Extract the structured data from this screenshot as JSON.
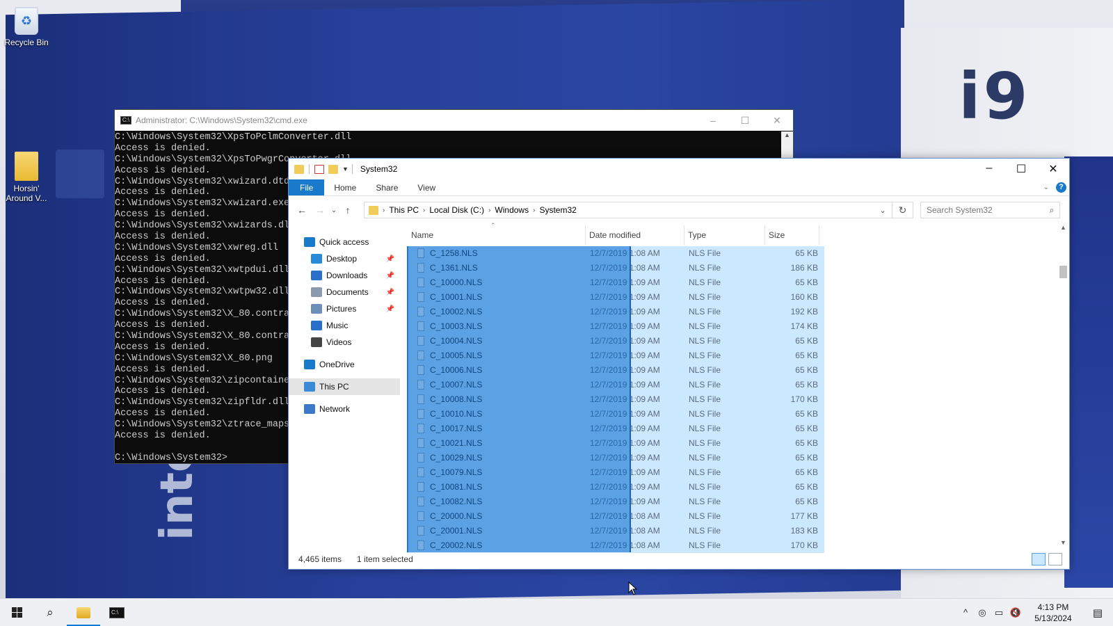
{
  "desktop": {
    "icons": [
      {
        "label": "Recycle Bin"
      },
      {
        "label": "Horsin' Around V..."
      }
    ],
    "wallpaper": {
      "logo_text": "i9",
      "brand_text": "intel CORE"
    }
  },
  "cmd": {
    "title": "Administrator: C:\\Windows\\System32\\cmd.exe",
    "lines": [
      "C:\\Windows\\System32\\XpsToPclmConverter.dll",
      "Access is denied.",
      "C:\\Windows\\System32\\XpsToPwgrConverter.dll",
      "Access is denied.",
      "C:\\Windows\\System32\\xwizard.dtd",
      "Access is denied.",
      "C:\\Windows\\System32\\xwizard.exe",
      "Access is denied.",
      "C:\\Windows\\System32\\xwizards.dll",
      "Access is denied.",
      "C:\\Windows\\System32\\xwreg.dll",
      "Access is denied.",
      "C:\\Windows\\System32\\xwtpdui.dll",
      "Access is denied.",
      "C:\\Windows\\System32\\xwtpw32.dll",
      "Access is denied.",
      "C:\\Windows\\System32\\X_80.contrast-black.png",
      "Access is denied.",
      "C:\\Windows\\System32\\X_80.contrast-white.png",
      "Access is denied.",
      "C:\\Windows\\System32\\X_80.png",
      "Access is denied.",
      "C:\\Windows\\System32\\zipcontainer.dll",
      "Access is denied.",
      "C:\\Windows\\System32\\zipfldr.dll",
      "Access is denied.",
      "C:\\Windows\\System32\\ztrace_maps.dll",
      "Access is denied.",
      "",
      "C:\\Windows\\System32>"
    ]
  },
  "explorer": {
    "title": "System32",
    "ribbon_tabs": [
      "File",
      "Home",
      "Share",
      "View"
    ],
    "breadcrumb": [
      "This PC",
      "Local Disk (C:)",
      "Windows",
      "System32"
    ],
    "search_placeholder": "Search System32",
    "nav": [
      {
        "label": "Quick access",
        "icon": "star-icon",
        "color": "#1979ca",
        "indent": 0,
        "pinned": false
      },
      {
        "label": "Desktop",
        "icon": "desktop-icon",
        "color": "#2a8ad8",
        "indent": 1,
        "pinned": true
      },
      {
        "label": "Downloads",
        "icon": "download-icon",
        "color": "#2a6fc9",
        "indent": 1,
        "pinned": true
      },
      {
        "label": "Documents",
        "icon": "documents-icon",
        "color": "#8a9bb0",
        "indent": 1,
        "pinned": true
      },
      {
        "label": "Pictures",
        "icon": "pictures-icon",
        "color": "#6b8fb8",
        "indent": 1,
        "pinned": true
      },
      {
        "label": "Music",
        "icon": "music-icon",
        "color": "#2a6fc9",
        "indent": 1,
        "pinned": false
      },
      {
        "label": "Videos",
        "icon": "videos-icon",
        "color": "#444",
        "indent": 1,
        "pinned": false
      },
      {
        "label": "OneDrive",
        "icon": "cloud-icon",
        "color": "#1979ca",
        "indent": 0,
        "pinned": false
      },
      {
        "label": "This PC",
        "icon": "computer-icon",
        "color": "#3a8ad8",
        "indent": 0,
        "pinned": false,
        "selected": true
      },
      {
        "label": "Network",
        "icon": "network-icon",
        "color": "#3a7ac8",
        "indent": 0,
        "pinned": false
      }
    ],
    "columns": [
      "Name",
      "Date modified",
      "Type",
      "Size"
    ],
    "files": [
      {
        "name": "C_1258.NLS",
        "date": "12/7/2019 1:08 AM",
        "type": "NLS File",
        "size": "65 KB"
      },
      {
        "name": "C_1361.NLS",
        "date": "12/7/2019 1:08 AM",
        "type": "NLS File",
        "size": "186 KB"
      },
      {
        "name": "C_10000.NLS",
        "date": "12/7/2019 1:09 AM",
        "type": "NLS File",
        "size": "65 KB"
      },
      {
        "name": "C_10001.NLS",
        "date": "12/7/2019 1:09 AM",
        "type": "NLS File",
        "size": "160 KB"
      },
      {
        "name": "C_10002.NLS",
        "date": "12/7/2019 1:09 AM",
        "type": "NLS File",
        "size": "192 KB"
      },
      {
        "name": "C_10003.NLS",
        "date": "12/7/2019 1:09 AM",
        "type": "NLS File",
        "size": "174 KB"
      },
      {
        "name": "C_10004.NLS",
        "date": "12/7/2019 1:09 AM",
        "type": "NLS File",
        "size": "65 KB"
      },
      {
        "name": "C_10005.NLS",
        "date": "12/7/2019 1:09 AM",
        "type": "NLS File",
        "size": "65 KB"
      },
      {
        "name": "C_10006.NLS",
        "date": "12/7/2019 1:09 AM",
        "type": "NLS File",
        "size": "65 KB"
      },
      {
        "name": "C_10007.NLS",
        "date": "12/7/2019 1:09 AM",
        "type": "NLS File",
        "size": "65 KB"
      },
      {
        "name": "C_10008.NLS",
        "date": "12/7/2019 1:09 AM",
        "type": "NLS File",
        "size": "170 KB"
      },
      {
        "name": "C_10010.NLS",
        "date": "12/7/2019 1:09 AM",
        "type": "NLS File",
        "size": "65 KB"
      },
      {
        "name": "C_10017.NLS",
        "date": "12/7/2019 1:09 AM",
        "type": "NLS File",
        "size": "65 KB"
      },
      {
        "name": "C_10021.NLS",
        "date": "12/7/2019 1:09 AM",
        "type": "NLS File",
        "size": "65 KB"
      },
      {
        "name": "C_10029.NLS",
        "date": "12/7/2019 1:09 AM",
        "type": "NLS File",
        "size": "65 KB"
      },
      {
        "name": "C_10079.NLS",
        "date": "12/7/2019 1:09 AM",
        "type": "NLS File",
        "size": "65 KB"
      },
      {
        "name": "C_10081.NLS",
        "date": "12/7/2019 1:09 AM",
        "type": "NLS File",
        "size": "65 KB"
      },
      {
        "name": "C_10082.NLS",
        "date": "12/7/2019 1:09 AM",
        "type": "NLS File",
        "size": "65 KB"
      },
      {
        "name": "C_20000.NLS",
        "date": "12/7/2019 1:08 AM",
        "type": "NLS File",
        "size": "177 KB"
      },
      {
        "name": "C_20001.NLS",
        "date": "12/7/2019 1:08 AM",
        "type": "NLS File",
        "size": "183 KB"
      },
      {
        "name": "C_20002.NLS",
        "date": "12/7/2019 1:08 AM",
        "type": "NLS File",
        "size": "170 KB"
      }
    ],
    "status": {
      "items": "4,465 items",
      "selected": "1 item selected"
    }
  },
  "taskbar": {
    "time": "4:13 PM",
    "date": "5/13/2024",
    "accent": "#0a78d7"
  }
}
